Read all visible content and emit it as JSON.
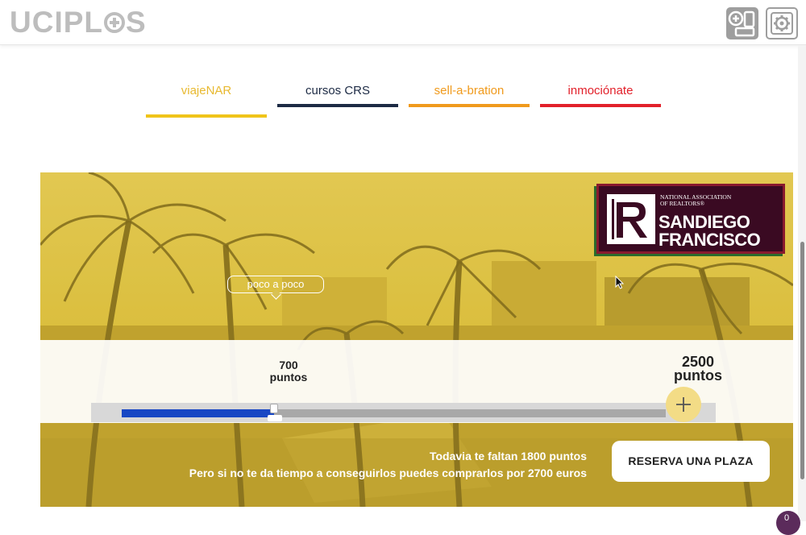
{
  "header": {
    "logo_text_left": "UCIPL",
    "logo_text_right": "S",
    "add_button_icon": "add-device-icon",
    "settings_button_icon": "settings-gear-icon"
  },
  "tabs": [
    {
      "label": "viajeNAR",
      "color": "#f0c419",
      "active": true
    },
    {
      "label": "cursos CRS",
      "color": "#1c2a44",
      "active": false
    },
    {
      "label": "sell-a-bration",
      "color": "#f09a1c",
      "active": false
    },
    {
      "label": "inmociónate",
      "color": "#e2202a",
      "active": false
    }
  ],
  "banner": {
    "logo": {
      "small_text": "NATIONAL ASSOCIATION of REALTORS®",
      "city_line1": "SANDIEGO",
      "city_line2": "FRANCISCO"
    },
    "tooltip": "poco a poco",
    "progress": {
      "current_value": "700",
      "current_unit": "puntos",
      "goal_value": "2500",
      "goal_unit": "puntos",
      "fraction": 0.28
    },
    "missing_text": "Todavia te faltan 1800 puntos",
    "buy_text": "Pero si no te da tiempo a conseguirlos puedes comprarlos por 2700 euros",
    "reserve_button": "RESERVA UNA PLAZA"
  },
  "chat_badge": "0",
  "colors": {
    "banner_overlay": "#d9bd3e",
    "progress_fill": "#1847c4",
    "logo_bg": "#3a0a22"
  }
}
